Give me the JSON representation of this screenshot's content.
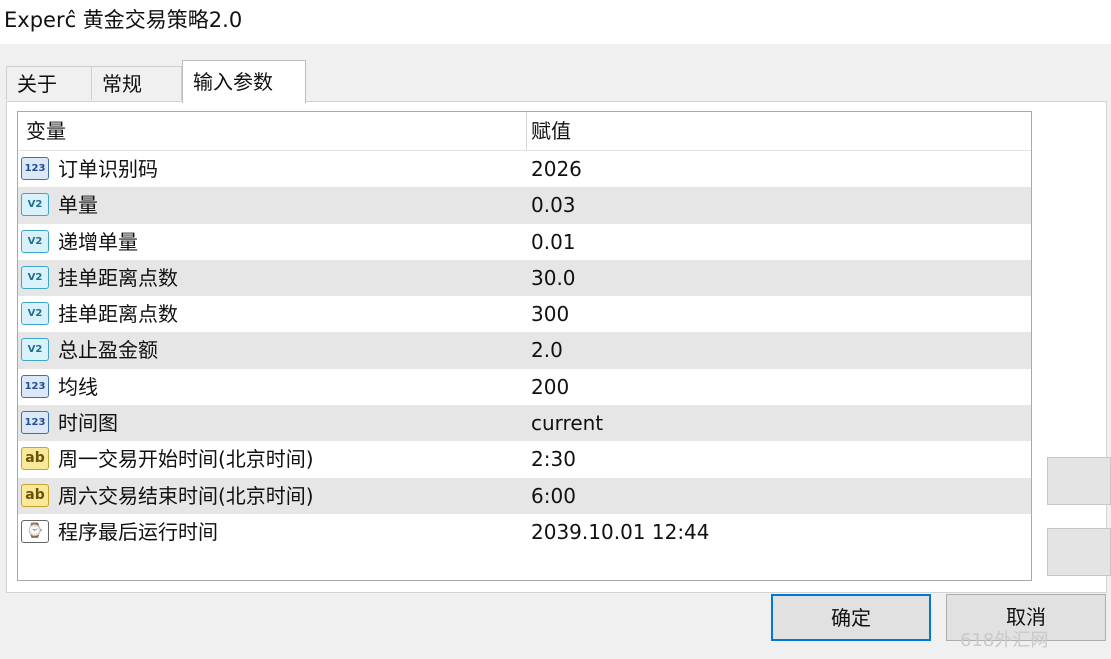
{
  "window": {
    "title": "Experĉ 黄金交易策略2.0"
  },
  "tabs": [
    {
      "label": "关于"
    },
    {
      "label": "常规"
    },
    {
      "label": "输入参数"
    }
  ],
  "table": {
    "columns": {
      "variable": "变量",
      "value": "赋值"
    },
    "rows": [
      {
        "icon": "int",
        "icon_text": "123",
        "name": "订单识别码",
        "value": "2026"
      },
      {
        "icon": "dbl",
        "icon_text": "V2",
        "name": "单量",
        "value": "0.03"
      },
      {
        "icon": "dbl",
        "icon_text": "V2",
        "name": "递增单量",
        "value": "0.01"
      },
      {
        "icon": "dbl",
        "icon_text": "V2",
        "name": "挂单距离点数",
        "value": "30.0"
      },
      {
        "icon": "dbl",
        "icon_text": "V2",
        "name": "挂单距离点数",
        "value": "300"
      },
      {
        "icon": "dbl",
        "icon_text": "V2",
        "name": "总止盈金额",
        "value": "2.0"
      },
      {
        "icon": "int",
        "icon_text": "123",
        "name": "均线",
        "value": "200"
      },
      {
        "icon": "int",
        "icon_text": "123",
        "name": "时间图",
        "value": "current"
      },
      {
        "icon": "str",
        "icon_text": "ab",
        "name": "周一交易开始时间(北京时间)",
        "value": "2:30"
      },
      {
        "icon": "str",
        "icon_text": "ab",
        "name": "周六交易结束时间(北京时间)",
        "value": "6:00"
      },
      {
        "icon": "dt",
        "icon_text": "⌚",
        "name": "程序最后运行时间",
        "value": "2039.10.01 12:44"
      }
    ]
  },
  "buttons": {
    "ok": "确定",
    "cancel": "取消"
  },
  "watermark": "618外汇网"
}
